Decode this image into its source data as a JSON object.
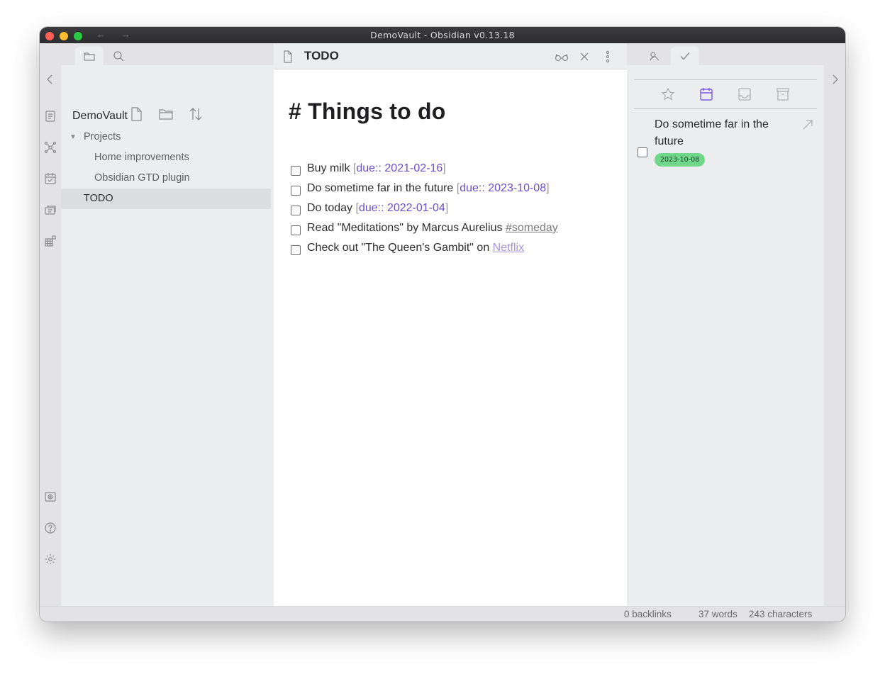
{
  "window": {
    "title": "DemoVault - Obsidian v0.13.18"
  },
  "titlebar": {
    "back": "←",
    "forward": "→"
  },
  "left_sidebar": {
    "tabs": [
      "file-explorer",
      "search"
    ],
    "actions": [
      "new-note",
      "new-folder",
      "change-sort-order"
    ],
    "vault_name": "DemoVault",
    "tree": [
      {
        "label": "Projects",
        "type": "folder",
        "expanded": true
      },
      {
        "label": "Home improvements",
        "type": "file",
        "indent": 1
      },
      {
        "label": "Obsidian GTD plugin",
        "type": "file",
        "indent": 1
      },
      {
        "label": "TODO",
        "type": "file",
        "selected": true
      }
    ]
  },
  "editor": {
    "tab_title": "TODO",
    "heading": "# Things to do",
    "tasks": [
      {
        "text": "Buy milk ",
        "open": "[",
        "meta": "due:: 2021-02-16",
        "close": "]"
      },
      {
        "text": "Do sometime far in the future ",
        "open": "[",
        "meta": "due:: 2023-10-08",
        "close": "]"
      },
      {
        "text": "Do today ",
        "open": "[",
        "meta": "due:: 2022-01-04",
        "close": "]"
      },
      {
        "text": "Read \"Meditations\" by Marcus Aurelius ",
        "tag": "#someday"
      },
      {
        "text": "Check out \"The Queen's Gambit\" on ",
        "link": "Netflix"
      }
    ]
  },
  "right_sidebar": {
    "tabs": [
      "backlinks",
      "gtd"
    ],
    "gtd_views": [
      "starred",
      "scheduled",
      "inbox",
      "someday"
    ],
    "active_view": "scheduled",
    "items": [
      {
        "text": "Do sometime far in the future",
        "date": "2023-10-08"
      }
    ]
  },
  "statusbar": {
    "backlinks": "0 backlinks",
    "words": "37 words",
    "characters": "243 characters"
  },
  "colors": {
    "accent": "#7a5ae0",
    "due": "#6c4ecb",
    "badge": "#6fd68a"
  }
}
